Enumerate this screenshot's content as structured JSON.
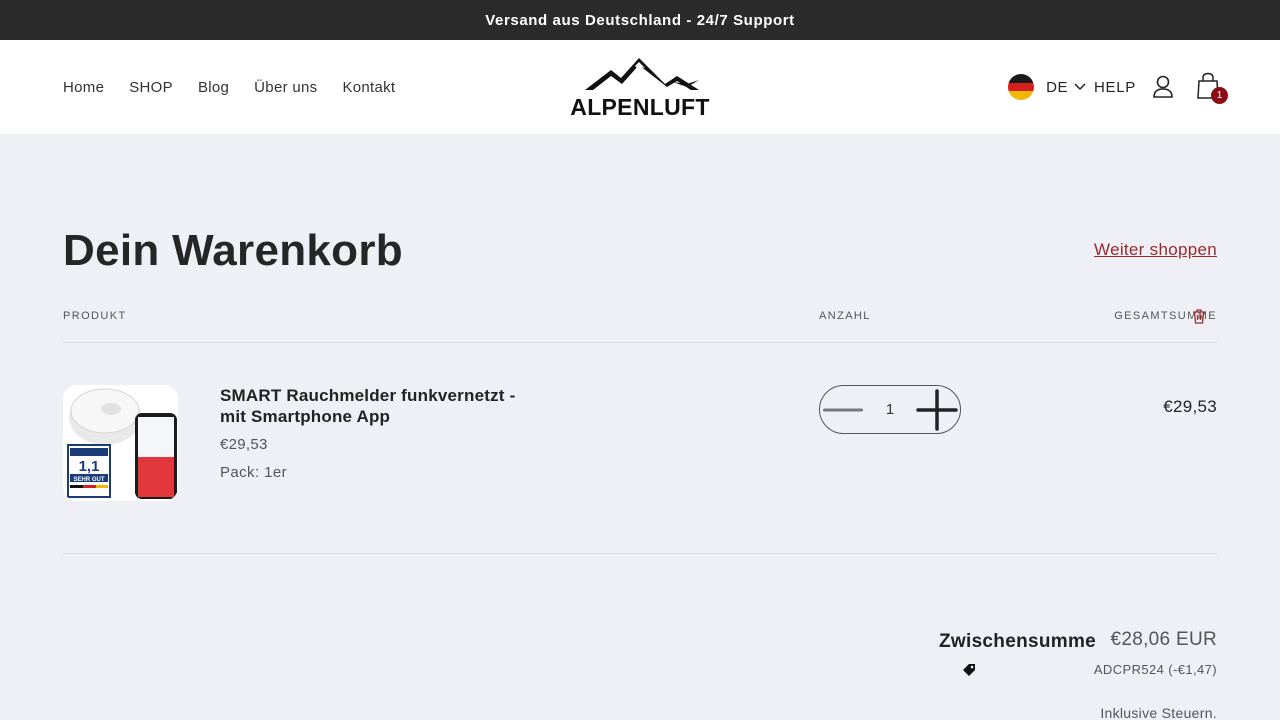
{
  "announcement": "Versand aus Deutschland - 24/7 Support",
  "nav": [
    "Home",
    "SHOP",
    "Blog",
    "Über uns",
    "Kontakt"
  ],
  "brand": "ALPENLUFT",
  "header_right": {
    "language": "DE",
    "help": "HELP",
    "cart_count": "1"
  },
  "cart": {
    "title": "Dein Warenkorb",
    "continue_shopping": "Weiter shoppen",
    "columns": {
      "product": "PRODUKT",
      "quantity": "ANZAHL",
      "total": "GESAMTSUMME"
    },
    "item": {
      "name": "SMART Rauchmelder funkvernetzt - mit Smartphone App",
      "price": "€29,53",
      "variant": "Pack: 1er",
      "quantity": "1",
      "line_total": "€29,53"
    },
    "summary": {
      "subtotal_label": "Zwischensumme",
      "subtotal_value": "€28,06 EUR",
      "discount": "ADCPR524 (-€1,47)",
      "tax_note": "Inklusive Steuern."
    }
  },
  "icons": {
    "flag": "germany-flag-icon",
    "chevron": "chevron-down-icon",
    "account": "user-icon",
    "cart": "shopping-bag-icon",
    "remove": "trash-icon",
    "minus": "minus-icon",
    "plus": "plus-icon",
    "discount": "tag-icon"
  },
  "colors": {
    "accent": "#9a2a2e",
    "badge": "#8b0d12",
    "announcement_bg": "#2b2b2b",
    "page_bg": "#eef0f6"
  }
}
